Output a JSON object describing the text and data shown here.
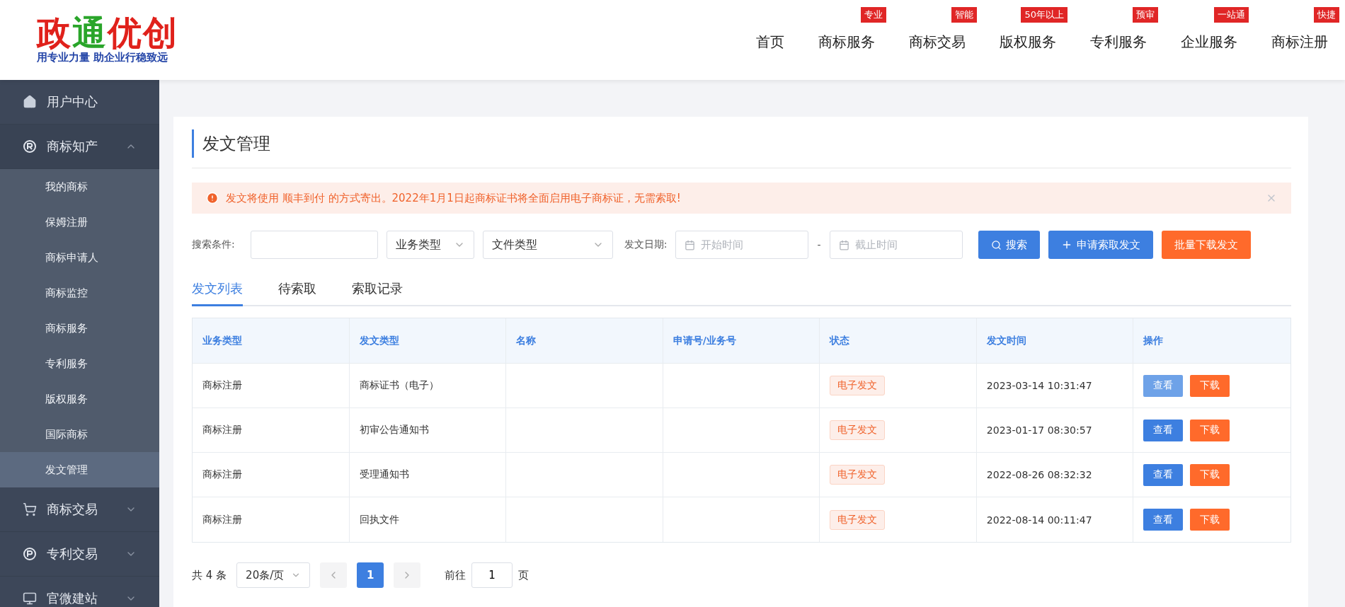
{
  "logo": {
    "chars": [
      {
        "text": "政",
        "color": "#e0211b"
      },
      {
        "text": "通",
        "color": "#2aa52a"
      },
      {
        "text": "优",
        "color": "#e0211b"
      },
      {
        "text": "创",
        "color": "#e0211b"
      }
    ],
    "slogan": "用专业力量 助企业行稳致远"
  },
  "nav": [
    {
      "label": "首页"
    },
    {
      "label": "商标服务",
      "badge": "专业"
    },
    {
      "label": "商标交易",
      "badge": "智能"
    },
    {
      "label": "版权服务",
      "badge": "50年以上"
    },
    {
      "label": "专利服务",
      "badge": "预审"
    },
    {
      "label": "企业服务",
      "badge": "一站通"
    },
    {
      "label": "商标注册",
      "badge": "快捷"
    }
  ],
  "sidebar": {
    "items": [
      {
        "label": "用户中心"
      },
      {
        "label": "商标知产",
        "expanded": true,
        "children": [
          {
            "label": "我的商标",
            "selected": false
          },
          {
            "label": "保姆注册",
            "selected": false
          },
          {
            "label": "商标申请人",
            "selected": false
          },
          {
            "label": "商标监控",
            "selected": false
          },
          {
            "label": "商标服务",
            "selected": false
          },
          {
            "label": "专利服务",
            "selected": false
          },
          {
            "label": "版权服务",
            "selected": false
          },
          {
            "label": "国际商标",
            "selected": false
          },
          {
            "label": "发文管理",
            "selected": true
          }
        ]
      },
      {
        "label": "商标交易",
        "expanded": false
      },
      {
        "label": "专利交易",
        "expanded": false
      },
      {
        "label": "官微建站",
        "expanded": false
      }
    ]
  },
  "page": {
    "title": "发文管理",
    "alert": {
      "text": "发文将使用 顺丰到付 的方式寄出。2022年1月1日起商标证书将全面启用电子商标证，无需索取!"
    },
    "filters": {
      "search_label": "搜索条件:",
      "business_type": {
        "placeholder": "业务类型"
      },
      "file_type": {
        "placeholder": "文件类型"
      },
      "date_label": "发文日期:",
      "start": {
        "placeholder": "开始时间"
      },
      "separator": "-",
      "end": {
        "placeholder": "截止时间"
      },
      "buttons": [
        {
          "label": "搜索",
          "kind": "search"
        },
        {
          "label": "申请索取发文",
          "kind": "add"
        },
        {
          "label": "批量下载发文",
          "kind": "download"
        }
      ]
    },
    "tabs": [
      {
        "label": "发文列表",
        "selected": true
      },
      {
        "label": "待索取",
        "selected": false
      },
      {
        "label": "索取记录",
        "selected": false
      }
    ],
    "table": {
      "columns": [
        "业务类型",
        "发文类型",
        "名称",
        "申请号/业务号",
        "状态",
        "发文时间",
        "操作"
      ],
      "rows": [
        {
          "business": "商标注册",
          "doc_type": "商标证书（电子）",
          "status": "电子发文",
          "time": "2023-03-14 10:31:47",
          "view": "查看",
          "view_disabled": true,
          "download": "下载"
        },
        {
          "business": "商标注册",
          "doc_type": "初审公告通知书",
          "status": "电子发文",
          "time": "2023-01-17 08:30:57",
          "view": "查看",
          "view_disabled": false,
          "download": "下载"
        },
        {
          "business": "商标注册",
          "doc_type": "受理通知书",
          "status": "电子发文",
          "time": "2022-08-26 08:32:32",
          "view": "查看",
          "view_disabled": false,
          "download": "下载"
        },
        {
          "business": "商标注册",
          "doc_type": "回执文件",
          "status": "电子发文",
          "time": "2022-08-14 00:11:47",
          "view": "查看",
          "view_disabled": false,
          "download": "下载"
        }
      ]
    },
    "pagination": {
      "total": "共 4 条",
      "page_size": "20条/页",
      "pages": [
        {
          "label": "1",
          "selected": true
        }
      ],
      "goto_label": "前往",
      "goto_value": "1",
      "goto_suffix": "页"
    }
  }
}
